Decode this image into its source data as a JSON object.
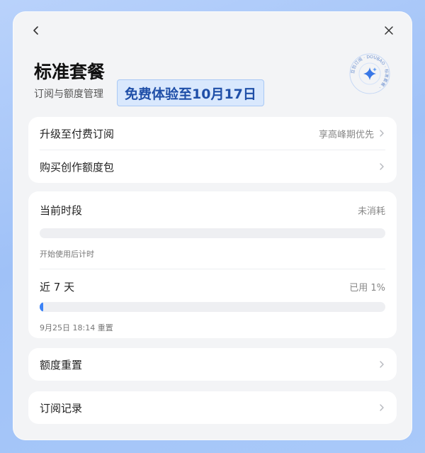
{
  "header": {
    "title": "标准套餐",
    "subtitle": "订阅与额度管理",
    "trial_badge": "免费体验至10月17日",
    "seal_text": "豆包订阅 · DOUBAO · 标准套餐 ·"
  },
  "upgrade_card": {
    "upgrade_label": "升级至付费订阅",
    "upgrade_hint": "享高峰期优先",
    "buy_label": "购买创作额度包"
  },
  "usage_card": {
    "current": {
      "label": "当前时段",
      "status": "未消耗",
      "progress": 0,
      "note": "开始使用后计时"
    },
    "week": {
      "label": "近 7 天",
      "status": "已用 1%",
      "progress": 1,
      "note": "9月25日 18:14 重置"
    }
  },
  "reset_row": {
    "label": "额度重置"
  },
  "history_row": {
    "label": "订阅记录"
  },
  "colors": {
    "accent": "#3b82f6",
    "badge_bg": "#d9e8fd",
    "badge_text": "#1f4fa8"
  }
}
